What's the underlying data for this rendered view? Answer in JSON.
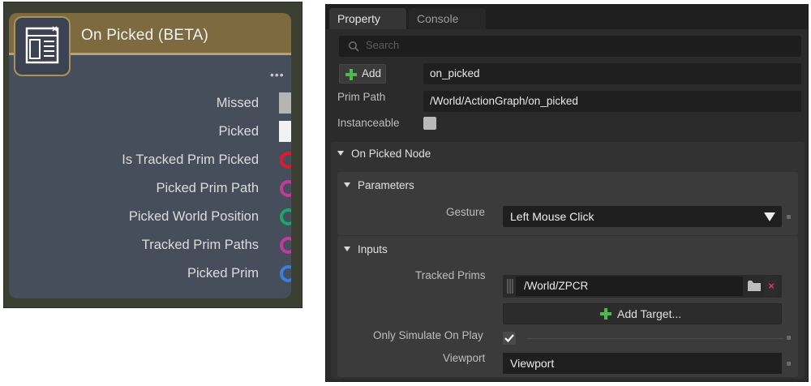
{
  "node": {
    "title": "On Picked (BETA)",
    "more_glyph": "•••",
    "icon": "document-list-icon",
    "ports": [
      {
        "label": "Missed",
        "kind": "exec"
      },
      {
        "label": "Picked",
        "kind": "exec"
      },
      {
        "label": "Is Tracked Prim Picked",
        "kind": "circle",
        "color": "#e0192c"
      },
      {
        "label": "Picked Prim Path",
        "kind": "circle",
        "color": "#c23a9b"
      },
      {
        "label": "Picked World Position",
        "kind": "circle",
        "color": "#1aa56a"
      },
      {
        "label": "Tracked Prim Paths",
        "kind": "circle",
        "color": "#c23a9b"
      },
      {
        "label": "Picked Prim",
        "kind": "circle",
        "color": "#3a7fd8"
      }
    ]
  },
  "panel": {
    "tabs": [
      {
        "label": "Property",
        "active": true
      },
      {
        "label": "Console",
        "active": false
      }
    ],
    "search_placeholder": "Search",
    "add_label": "Add",
    "name_value": "on_picked",
    "prim_path_label": "Prim Path",
    "prim_path_value": "/World/ActionGraph/on_picked",
    "instanceable_label": "Instanceable",
    "section_node": "On Picked Node",
    "section_parameters": "Parameters",
    "gesture_label": "Gesture",
    "gesture_value": "Left Mouse Click",
    "section_inputs": "Inputs",
    "tracked_prims_label": "Tracked Prims",
    "tracked_prim_value": "/World/ZPCR",
    "remove_glyph": "×",
    "add_target_label": "Add Target...",
    "only_simulate_label": "Only Simulate On Play",
    "only_simulate_checked": true,
    "viewport_label": "Viewport",
    "viewport_value": "Viewport",
    "colors": {
      "accent_green": "#4cbb4c",
      "remove_red": "#e53a52"
    }
  }
}
